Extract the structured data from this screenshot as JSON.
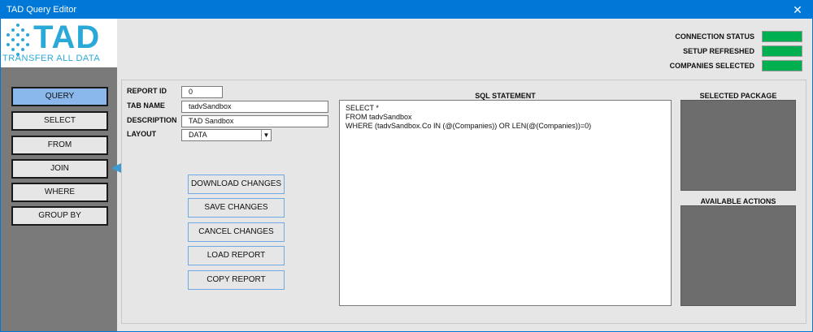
{
  "window": {
    "title": "TAD Query Editor",
    "close_glyph": "✕"
  },
  "logo": {
    "main": "TAD",
    "tagline": "TRANSFER ALL DATA"
  },
  "sidebar": {
    "items": [
      {
        "label": "QUERY",
        "active": true
      },
      {
        "label": "SELECT",
        "active": false
      },
      {
        "label": "FROM",
        "active": false
      },
      {
        "label": "JOIN",
        "active": false
      },
      {
        "label": "WHERE",
        "active": false
      },
      {
        "label": "GROUP BY",
        "active": false
      }
    ]
  },
  "status": {
    "connection": "CONNECTION STATUS",
    "setup": "SETUP REFRESHED",
    "companies": "COMPANIES SELECTED",
    "indicator_color": "#00b050"
  },
  "form": {
    "report_id_label": "REPORT ID",
    "report_id_value": "0",
    "tab_name_label": "TAB NAME",
    "tab_name_value": "tadvSandbox",
    "description_label": "DESCRIPTION",
    "description_value": "TAD Sandbox",
    "layout_label": "LAYOUT",
    "layout_value": "DATA"
  },
  "actions": {
    "download": "DOWNLOAD CHANGES",
    "save": "SAVE CHANGES",
    "cancel": "CANCEL CHANGES",
    "load": "LOAD REPORT",
    "copy": "COPY REPORT"
  },
  "sql": {
    "title": "SQL STATEMENT",
    "lines": [
      "SELECT *",
      "FROM tadvSandbox",
      "WHERE (tadvSandbox.Co IN (@(Companies)) OR LEN(@(Companies))=0)"
    ]
  },
  "right": {
    "selected_package": "SELECTED PACKAGE",
    "available_actions": "AVAILABLE ACTIONS"
  },
  "colors": {
    "titlebar": "#0078d7",
    "active_nav": "#8ab8ec",
    "arrow": "#3c9ad4",
    "logo": "#2aa9d8"
  }
}
